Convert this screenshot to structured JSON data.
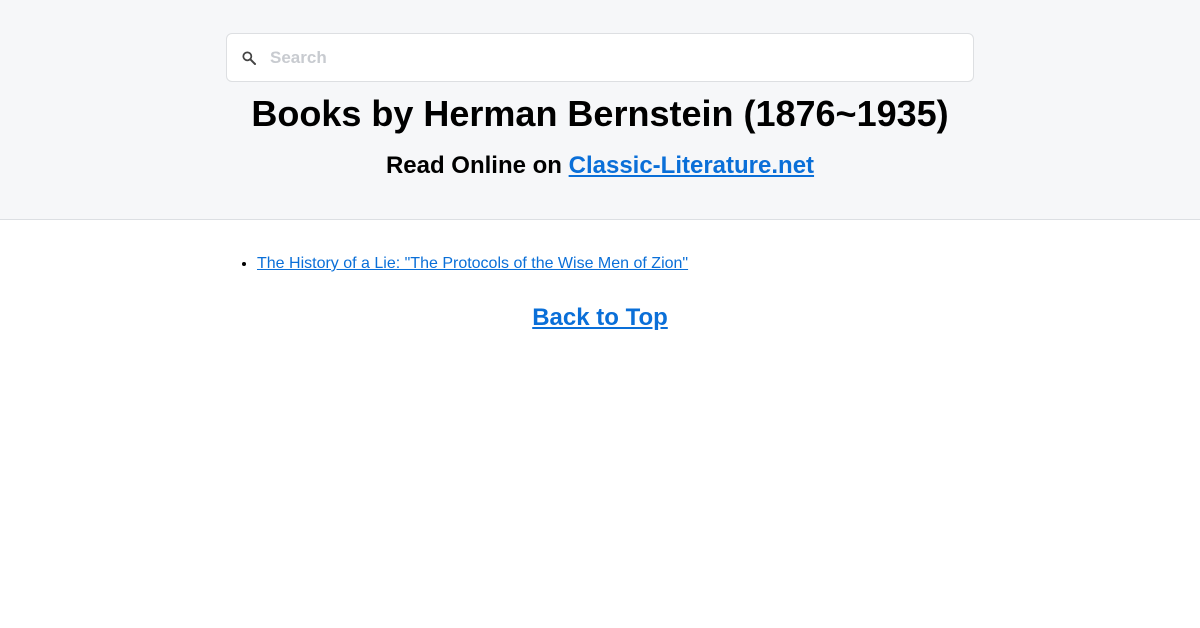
{
  "search": {
    "placeholder": "Search",
    "icon": "search-icon"
  },
  "header": {
    "title": "Books by Herman Bernstein (1876~1935)",
    "subtitle_prefix": "Read Online on ",
    "subtitle_link": "Classic-Literature.net"
  },
  "books": [
    "The History of a Lie: \"The Protocols of the Wise Men of Zion\""
  ],
  "footer": {
    "back_to_top": "Back to Top"
  },
  "colors": {
    "link": "#0a6fd8",
    "header_bg": "#f6f7f9"
  }
}
